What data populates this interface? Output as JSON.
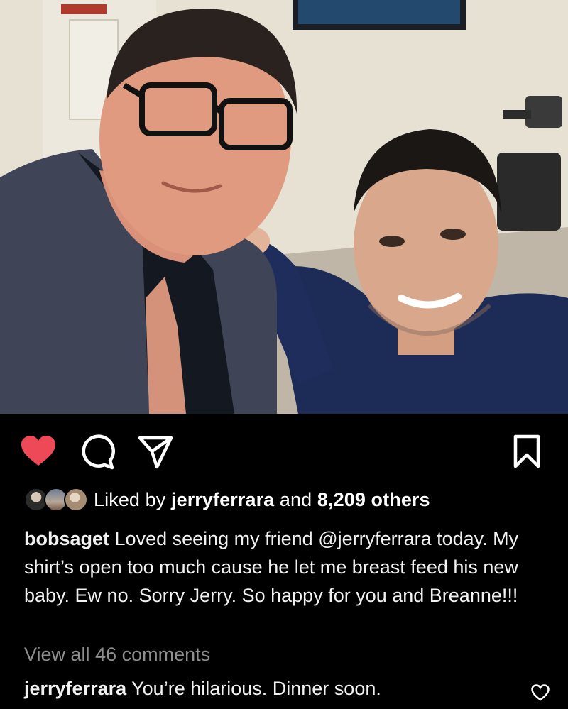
{
  "post": {
    "photo_alt": "Two men taking a selfie backstage",
    "liked": true,
    "colors": {
      "like_red": "#ed4956",
      "background": "#000000",
      "muted_text": "#8e8e8e"
    },
    "icons": [
      "heart-icon",
      "comment-icon",
      "share-icon",
      "bookmark-icon",
      "heart-outline-icon"
    ]
  },
  "likes": {
    "prefix": "Liked by",
    "user": "jerryferrara",
    "joiner": "and",
    "others": "8,209 others"
  },
  "caption": {
    "username": "bobsaget",
    "text": "Loved seeing my friend @jerryferrara today. My shirt’s open too much cause he let me breast feed his new baby. Ew no. Sorry Jerry. So happy for you and Breanne!!!"
  },
  "comments": {
    "view_all": "View all 46 comments",
    "top_comment": {
      "username": "jerryferrara",
      "text": "You’re hilarious. Dinner soon."
    }
  }
}
